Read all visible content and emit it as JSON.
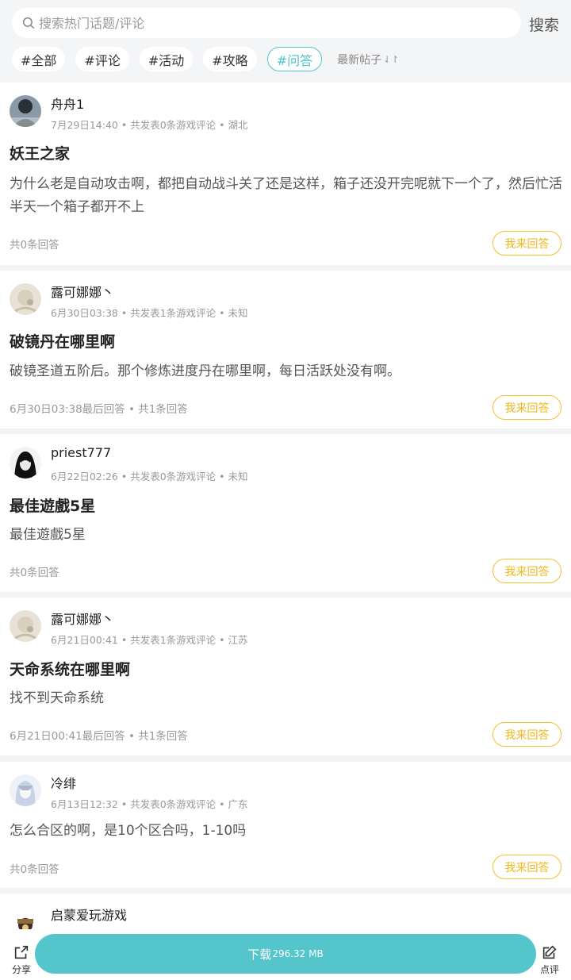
{
  "search": {
    "placeholder": "搜索热门话题/评论",
    "button_label": "搜索"
  },
  "tags": [
    {
      "label": "#全部"
    },
    {
      "label": "#评论"
    },
    {
      "label": "#活动"
    },
    {
      "label": "#攻略"
    },
    {
      "label": "#问答"
    }
  ],
  "sort_label": "最新帖子",
  "sort_icon": "⇃↾",
  "posts": [
    {
      "author": "舟舟1",
      "meta": "7月29日14:40 • 共发表0条游戏评论 • 湖北",
      "title": "妖王之家",
      "content": "为什么老是自动攻击啊，都把自动战斗关了还是这样，箱子还没开完呢就下一个了，然后忙活半天一个箱子都开不上",
      "footer": "共0条回答",
      "answer_label": "我来回答"
    },
    {
      "author": "露可娜娜丶",
      "meta": "6月30日03:38 • 共发表1条游戏评论 • 未知",
      "title": "破镜丹在哪里啊",
      "content": "破镜圣道五阶后。那个修炼进度丹在哪里啊，每日活跃处没有啊。",
      "footer": "6月30日03:38最后回答 • 共1条回答",
      "answer_label": "我来回答"
    },
    {
      "author": "priest777",
      "meta": "6月22日02:26 • 共发表0条游戏评论 • 未知",
      "title": "最佳遊戲5星",
      "content": "最佳遊戲5星",
      "footer": "共0条回答",
      "answer_label": "我来回答"
    },
    {
      "author": "露可娜娜丶",
      "meta": "6月21日00:41 • 共发表1条游戏评论 • 江苏",
      "title": "天命系统在哪里啊",
      "content": "找不到天命系统",
      "footer": "6月21日00:41最后回答 • 共1条回答",
      "answer_label": "我来回答"
    },
    {
      "author": "冷绯",
      "meta": "6月13日12:32 • 共发表0条游戏评论 • 广东",
      "title": "",
      "content": "怎么合区的啊，是10个区合吗，1-10吗",
      "footer": "共0条回答",
      "answer_label": "我来回答"
    },
    {
      "author": "启蒙爱玩游戏",
      "meta": "",
      "title": "",
      "content": "",
      "footer": "",
      "answer_label": ""
    }
  ],
  "bottom": {
    "share_label": "分享",
    "download_label": "下载",
    "download_size": "296.32 MB",
    "comment_label": "点评"
  },
  "colors": {
    "accent": "#55c5cc",
    "answer": "#f0b81c",
    "tag_active": "#4fc3cd"
  }
}
